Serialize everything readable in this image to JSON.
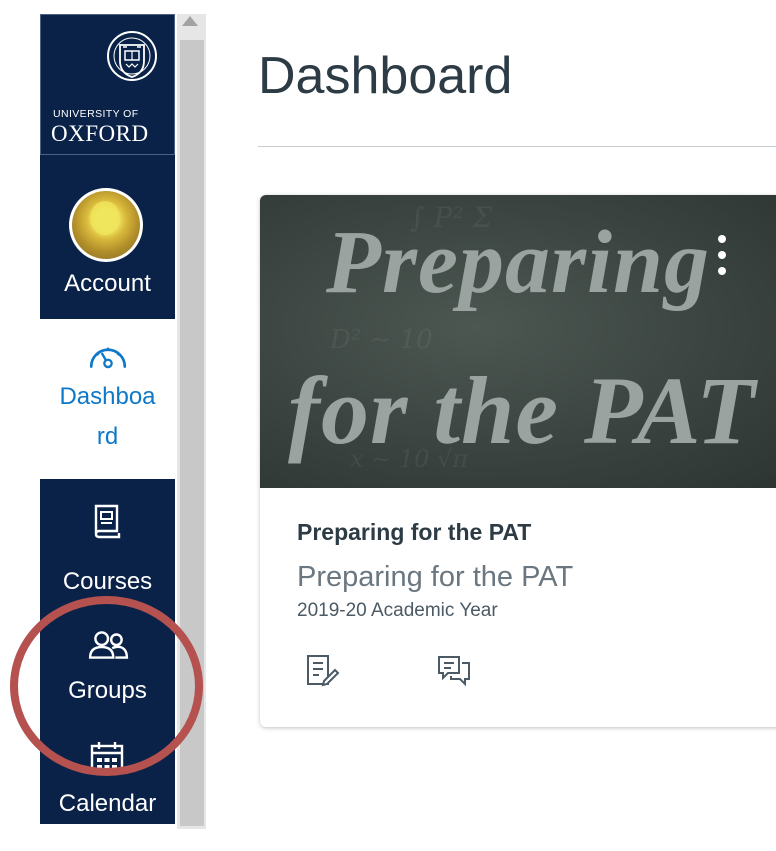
{
  "logo": {
    "line1": "UNIVERSITY OF",
    "line2": "OXFORD"
  },
  "nav": {
    "items": [
      {
        "label": "Account",
        "icon": "avatar",
        "active": false
      },
      {
        "label": "Dashboa\nrd",
        "icon": "dashboard-gauge-icon",
        "active": true
      },
      {
        "label": "Courses",
        "icon": "book-icon",
        "active": false
      },
      {
        "label": "Groups",
        "icon": "users-icon",
        "active": false
      },
      {
        "label": "Calendar",
        "icon": "calendar-icon",
        "active": false
      }
    ]
  },
  "page": {
    "title": "Dashboard"
  },
  "card": {
    "hero_line1": "Preparing",
    "hero_line2": "for the PAT",
    "title": "Preparing for the PAT",
    "subtitle": "Preparing for the PAT",
    "term": "2019-20 Academic Year",
    "actions": [
      {
        "icon": "assignments-icon"
      },
      {
        "icon": "discussions-icon"
      }
    ]
  },
  "colors": {
    "nav_bg": "#0b2248",
    "active_text": "#0e78c9",
    "title_text": "#2d3b45",
    "annotation": "#b5514f"
  }
}
